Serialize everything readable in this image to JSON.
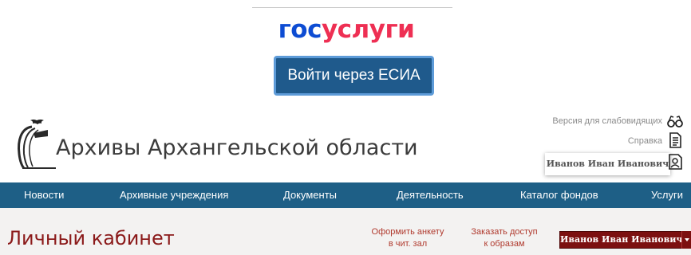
{
  "esia": {
    "logo_part1": "гос",
    "logo_part2": "услуги",
    "button_label": "Войти через ЕСИА"
  },
  "header": {
    "site_title": "Архивы Архангельской области",
    "accessibility_link": "Версия для слабовидящих",
    "help_link": "Справка",
    "user_name": "Иванов Иван Иванович"
  },
  "nav": {
    "items": [
      "Новости",
      "Архивные учреждения",
      "Документы",
      "Деятельность",
      "Каталог фондов",
      "Услуги"
    ]
  },
  "cabinet": {
    "title": "Личный кабинет",
    "link1_line1": "Оформить анкету",
    "link1_line2": "в чит. зал",
    "link2_line1": "Заказать доступ",
    "link2_line2": "к образам",
    "user_button": "Иванов Иван Иванович"
  },
  "colors": {
    "gos_blue": "#0d4cd3",
    "gos_red": "#ee2f53",
    "esia_button": "#1f5a8c",
    "nav_bg": "#1e5f86",
    "cabinet_title": "#8b1a1a",
    "user_button_bg": "#7c1010"
  }
}
